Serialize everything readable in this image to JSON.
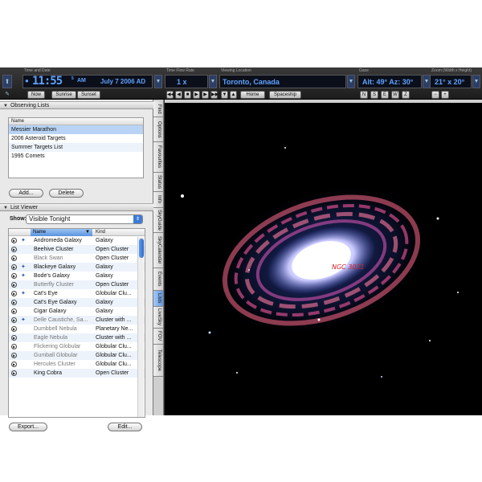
{
  "toolbar": {
    "time_label": "Time and Date",
    "clock": "11:55",
    "clock_seconds": "5",
    "am_pm": "AM",
    "date": "July   7   2006 AD",
    "now_label": "Now",
    "sunrise_label": "Sunrise",
    "sunset_label": "Sunset",
    "flow_label": "Time Flow Rate",
    "flow_value": "1 x",
    "location_label": "Viewing Location",
    "location_value": "Toronto, Canada",
    "home_label": "Home",
    "spaceship_label": "Spaceship",
    "gaze_label": "Gaze",
    "gaze_value": "Alt: 49° Az: 30°",
    "compass": [
      "N",
      "S",
      "E",
      "W",
      "Z"
    ],
    "zoom_label": "Zoom (Width x Height)",
    "zoom_value": "21° x 20°",
    "zoom_minus": "−",
    "zoom_plus": "+"
  },
  "observing_lists": {
    "header": "Observing Lists",
    "column": "Name",
    "items": [
      "Messier Marathon",
      "2006 Asteroid Targets",
      "Summer Targets List",
      "1995 Comets"
    ],
    "add_label": "Add...",
    "delete_label": "Delete"
  },
  "list_viewer": {
    "header": "List Viewer",
    "show_label": "Show:",
    "show_value": "Visible Tonight",
    "col_name": "Name",
    "col_kind": "Kind",
    "rows": [
      {
        "name": "Andromeda Galaxy",
        "kind": "Galaxy"
      },
      {
        "name": "Beehive Cluster",
        "kind": "Open Cluster"
      },
      {
        "name": "Black Swan",
        "kind": "Open Cluster"
      },
      {
        "name": "Blackeye Galaxy",
        "kind": "Galaxy"
      },
      {
        "name": "Bode's Galaxy",
        "kind": "Galaxy"
      },
      {
        "name": "Butterfly Cluster",
        "kind": "Open Cluster"
      },
      {
        "name": "Cat's Eye",
        "kind": "Globular Clu..."
      },
      {
        "name": "Cat's Eye Galaxy",
        "kind": "Galaxy"
      },
      {
        "name": "Cigar Galaxy",
        "kind": "Galaxy"
      },
      {
        "name": "Delle Caustiche, Sa...",
        "kind": "Cluster with ..."
      },
      {
        "name": "Dumbbell Nebula",
        "kind": "Planetary Ne..."
      },
      {
        "name": "Eagle Nebula",
        "kind": "Cluster with ..."
      },
      {
        "name": "Flickering Globular",
        "kind": "Globular Clu..."
      },
      {
        "name": "Gumball Globular",
        "kind": "Globular Clu..."
      },
      {
        "name": "Hercules Cluster",
        "kind": "Globular Clu..."
      },
      {
        "name": "King Cobra",
        "kind": "Open Cluster"
      }
    ],
    "export_label": "Export...",
    "edit_label": "Edit..."
  },
  "side_tabs": [
    "Find",
    "Options",
    "Favourites",
    "Status",
    "Info",
    "SkyGuide",
    "SkyCalendar",
    "Events",
    "Lists",
    "LiveSky",
    "FOV",
    "Telescope"
  ],
  "selected_tab": "Lists",
  "sky": {
    "object_label": "NGC 3031"
  },
  "colors": {
    "selection_blue": "#b8d3f4",
    "lcd_text": "#5fa2ff",
    "object_label_red": "#d0202a"
  }
}
